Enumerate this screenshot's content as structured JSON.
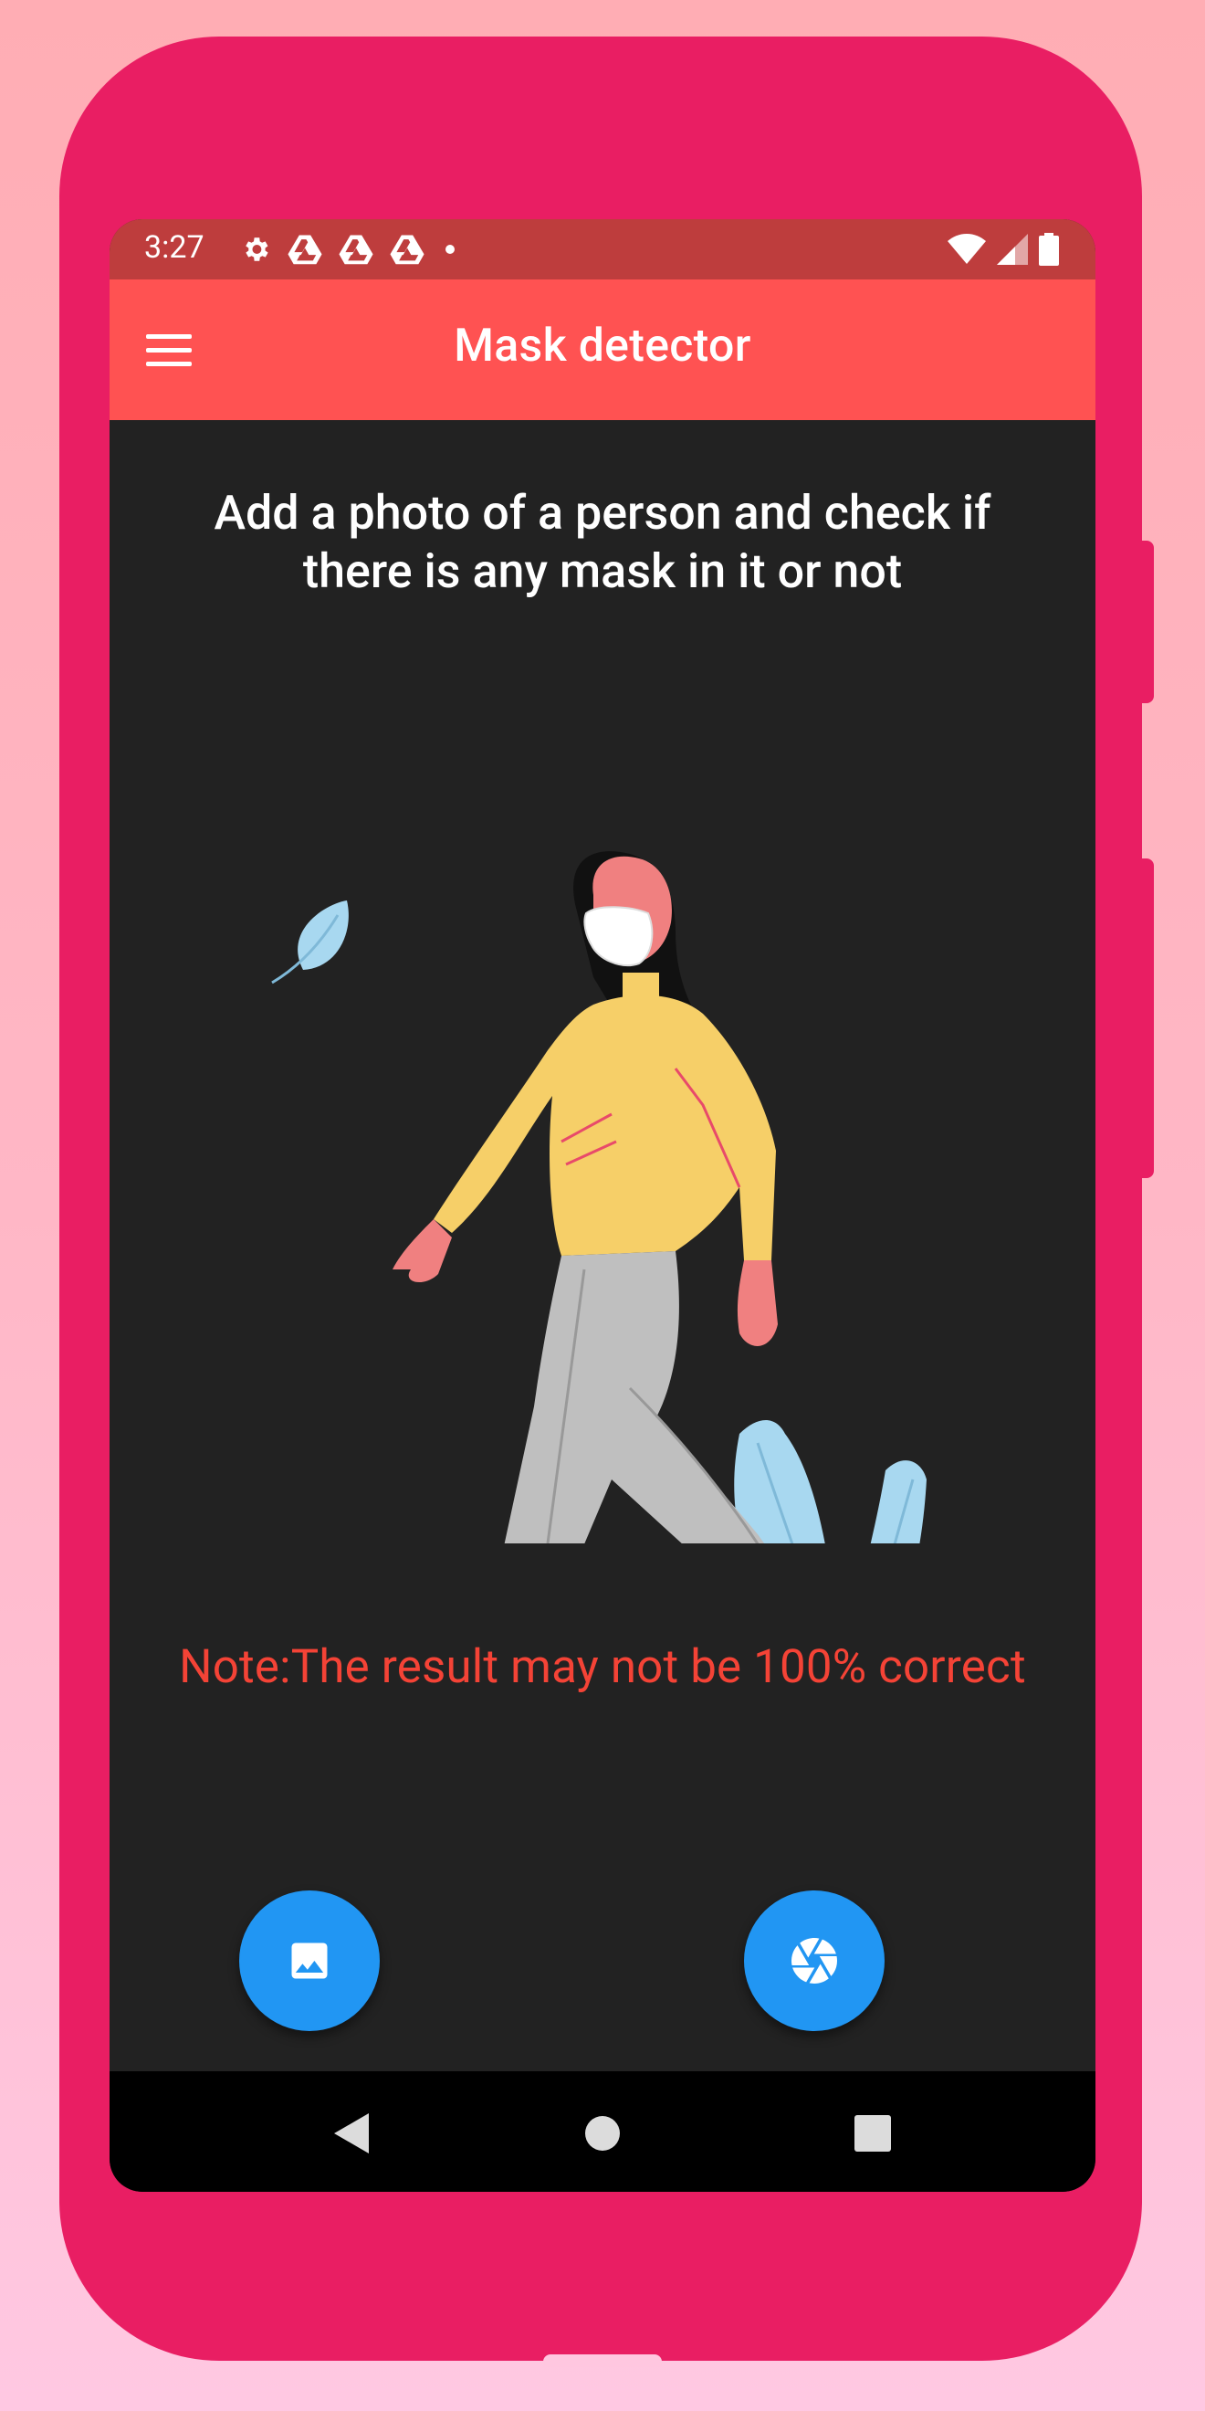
{
  "status_bar": {
    "time": "3:27",
    "left_icons": [
      "settings-icon",
      "drive-icon",
      "drive-icon",
      "drive-icon",
      "dot-icon"
    ],
    "right_icons": [
      "wifi-icon",
      "signal-icon",
      "battery-icon"
    ]
  },
  "app_bar": {
    "title": "Mask detector",
    "menu_icon": "hamburger-menu-icon"
  },
  "main": {
    "headline": "Add a photo of a person and check if there is any mask in it or not",
    "illustration": "woman-walking-with-mask",
    "note": "Note:The result may not be 100% correct"
  },
  "actions": {
    "gallery_icon": "image-icon",
    "camera_icon": "camera-shutter-icon"
  },
  "nav_bar": [
    "back-icon",
    "home-icon",
    "recents-icon"
  ],
  "colors": {
    "frame": "#e91e63",
    "status_bar": "#be3d3d",
    "app_bar": "#ff5252",
    "background": "#222222",
    "note_text": "#f44336",
    "fab": "#2196f3"
  }
}
